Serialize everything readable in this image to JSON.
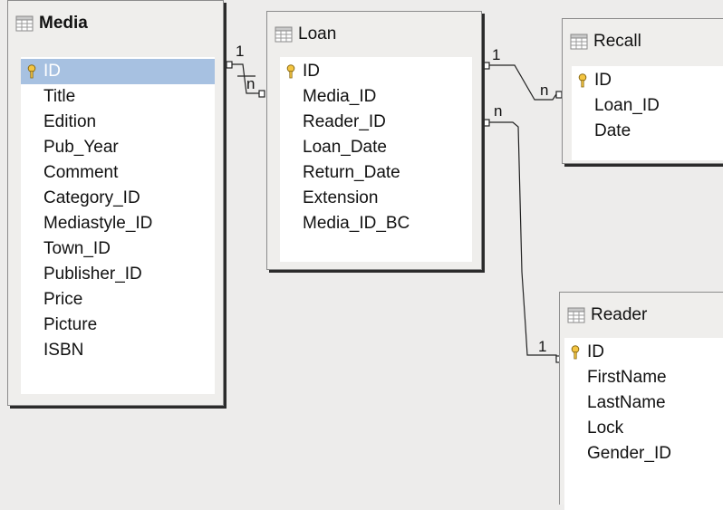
{
  "tables": {
    "media": {
      "title": "Media",
      "key_field": "ID",
      "fields": [
        "Title",
        "Edition",
        "Pub_Year",
        "Comment",
        "Category_ID",
        "Mediastyle_ID",
        "Town_ID",
        "Publisher_ID",
        "Price",
        "Picture",
        "ISBN"
      ]
    },
    "loan": {
      "title": "Loan",
      "key_field": "ID",
      "fields": [
        "Media_ID",
        "Reader_ID",
        "Loan_Date",
        "Return_Date",
        "Extension",
        "Media_ID_BC"
      ]
    },
    "recall": {
      "title": "Recall",
      "key_field": "ID",
      "fields": [
        "Loan_ID",
        "Date"
      ]
    },
    "reader": {
      "title": "Reader",
      "key_field": "ID",
      "fields": [
        "FirstName",
        "LastName",
        "Lock",
        "Gender_ID"
      ]
    }
  },
  "relations": [
    {
      "from": "Media.ID",
      "to": "Loan.Media_ID",
      "label_one": "1",
      "label_many": "n"
    },
    {
      "from": "Loan.ID",
      "to": "Recall.Loan_ID",
      "label_one": "1",
      "label_many": "n"
    },
    {
      "from": "Loan.Reader_ID",
      "to": "Reader.ID",
      "label_one": "1",
      "label_many": "n"
    }
  ],
  "colors": {
    "background": "#edeceb",
    "selection": "#a7c1e1",
    "key": "#e0a020",
    "shadow": "#2b2b2b"
  },
  "icons": {
    "table": "table-grid-icon",
    "key": "primary-key-icon"
  }
}
